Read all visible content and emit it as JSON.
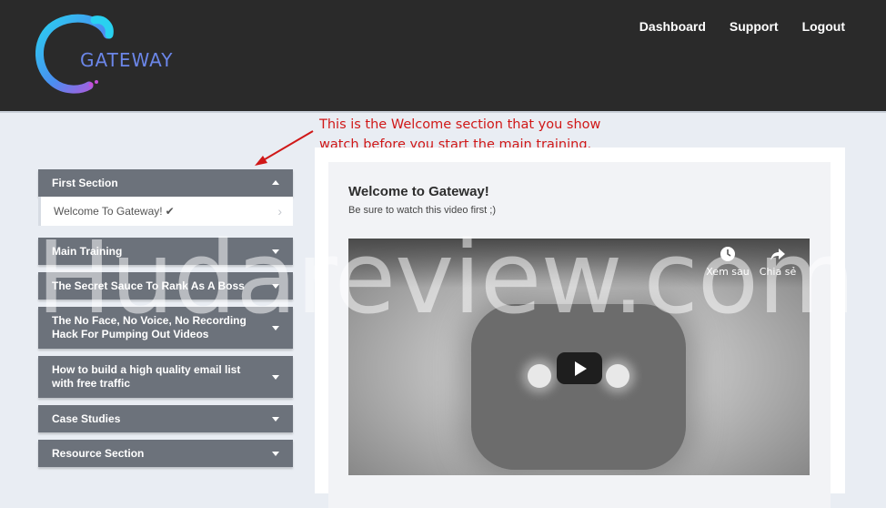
{
  "header": {
    "logo_text": "GATEWAY",
    "nav": [
      "Dashboard",
      "Support",
      "Logout"
    ]
  },
  "annotation": {
    "line1": "This is the Welcome section that you show",
    "line2": "watch before you start the main training.",
    "color": "#d01818"
  },
  "sidebar": {
    "sections": [
      {
        "label": "First Section",
        "expanded": true,
        "lessons": [
          {
            "label": "Welcome To Gateway!",
            "completed": true
          }
        ]
      },
      {
        "label": "Main Training",
        "expanded": false
      },
      {
        "label": "The Secret Sauce To Rank As A Boss",
        "expanded": false
      },
      {
        "label": "The No Face, No Voice, No Recording Hack For Pumping Out Videos",
        "expanded": false
      },
      {
        "label": "How to build a high quality email list with free traffic",
        "expanded": false
      },
      {
        "label": "Case Studies",
        "expanded": false
      },
      {
        "label": "Resource Section",
        "expanded": false
      }
    ]
  },
  "main": {
    "title": "Welcome to Gateway!",
    "subtitle": "Be sure to watch this video first ;)",
    "video": {
      "watch_later": "Xem sau",
      "share": "Chia sẻ"
    }
  },
  "watermark": "Hudareview.com",
  "colors": {
    "header_bg": "#2a2a2a",
    "section_header": "#6c727b",
    "page_bg": "#e9edf3",
    "logo_cyan": "#29d1f0",
    "logo_purple": "#8e4be0"
  }
}
